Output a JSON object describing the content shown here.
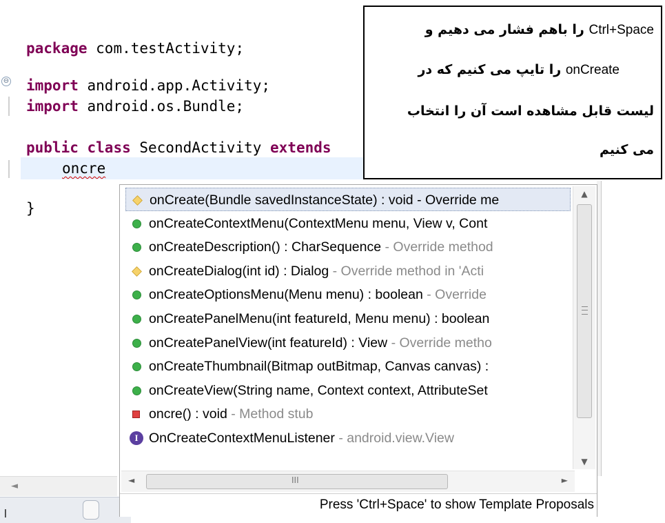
{
  "editor": {
    "lines": {
      "package_kw": "package",
      "package_rest": " com.testActivity;",
      "import1_kw": "import",
      "import1_rest": " android.app.Activity;",
      "import2_kw": "import",
      "import2_rest": " android.os.Bundle;",
      "class_kw1": "public",
      "class_kw2": "class",
      "class_name": " SecondActivity ",
      "class_kw3": "extends",
      "typed": "oncre",
      "close_brace": "}"
    },
    "fold_icon": "collapse-icon",
    "fold_symbol": "⊖"
  },
  "note": {
    "line1_en": "Ctrl+Space",
    "line1_fa": "را باهم فشار می دهیم  و",
    "line2_en": "onCreate",
    "line2_fa": "را تایپ می کنیم  که در",
    "line3_fa": "لیست قابل مشاهده  است آن را انتخاب",
    "line4_fa": "می کنیم"
  },
  "popup": {
    "items": [
      {
        "icon": "diamond-icon",
        "sig": "onCreate(Bundle savedInstanceState) : void",
        "detail": " - Override me",
        "detail_dim": false
      },
      {
        "icon": "green-dot-icon",
        "sig": "onCreateContextMenu(ContextMenu menu, View v, Cont",
        "detail": "",
        "detail_dim": false
      },
      {
        "icon": "green-dot-icon",
        "sig": "onCreateDescription() : CharSequence",
        "detail": " - Override method",
        "detail_dim": true
      },
      {
        "icon": "diamond-icon",
        "sig": "onCreateDialog(int id) : Dialog",
        "detail": " - Override method in 'Acti",
        "detail_dim": true
      },
      {
        "icon": "green-dot-icon",
        "sig": "onCreateOptionsMenu(Menu menu) : boolean",
        "detail": " - Override",
        "detail_dim": true
      },
      {
        "icon": "green-dot-icon",
        "sig": "onCreatePanelMenu(int featureId, Menu menu) : boolean",
        "detail": "",
        "detail_dim": false
      },
      {
        "icon": "green-dot-icon",
        "sig": "onCreatePanelView(int featureId) : View",
        "detail": " - Override metho",
        "detail_dim": true
      },
      {
        "icon": "green-dot-icon",
        "sig": "onCreateThumbnail(Bitmap outBitmap, Canvas canvas) :",
        "detail": "",
        "detail_dim": false
      },
      {
        "icon": "green-dot-icon",
        "sig": "onCreateView(String name, Context context, AttributeSet",
        "detail": "",
        "detail_dim": false
      },
      {
        "icon": "red-square-icon",
        "sig": "oncre() : void",
        "detail": " - Method stub",
        "detail_dim": true
      },
      {
        "icon": "interface-icon",
        "sig": "OnCreateContextMenuListener",
        "detail": " - android.view.View",
        "detail_dim": true
      }
    ],
    "interface_letter": "I",
    "scroll_up": "▲",
    "scroll_down": "▼",
    "scroll_left": "◄",
    "scroll_right": "►",
    "hthumb_grip": "III",
    "status": "Press 'Ctrl+Space' to show Template Proposals"
  },
  "bottom": {
    "tab_text": "l"
  }
}
